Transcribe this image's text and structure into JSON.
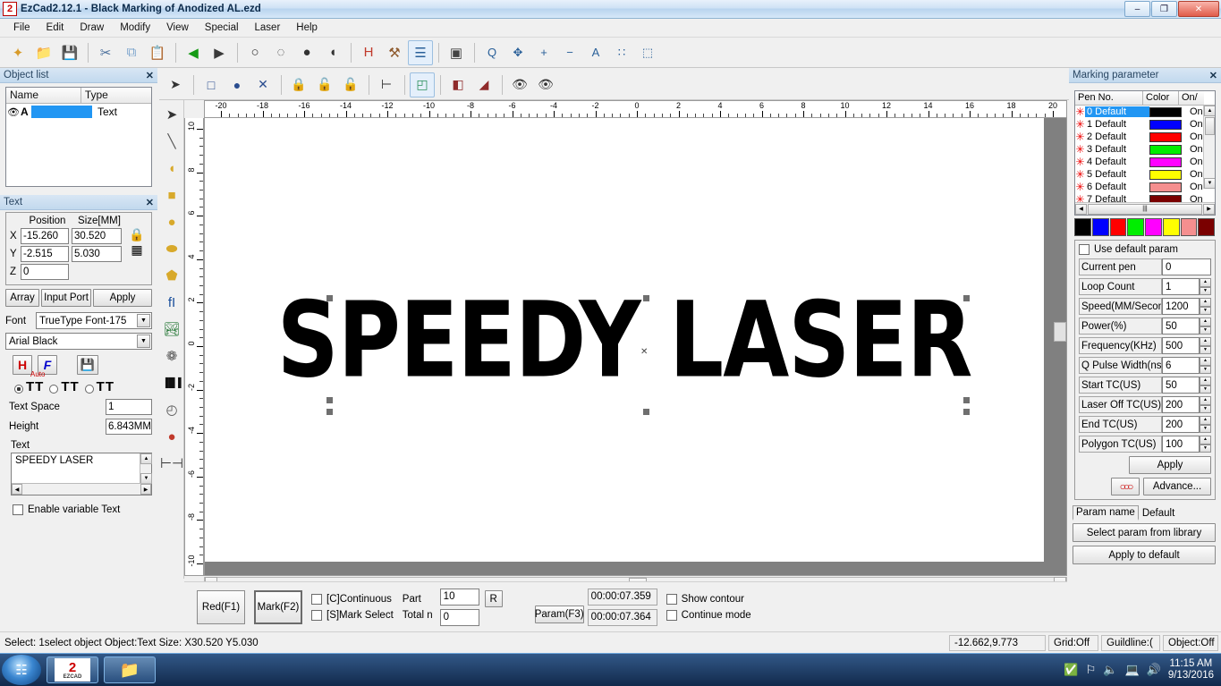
{
  "window": {
    "title": "EzCad2.12.1 - Black Marking of Anodized AL.ezd",
    "app_icon": "ezcad-logo-icon",
    "minimize": "–",
    "maximize": "❐",
    "close": "✕"
  },
  "menu": [
    "File",
    "Edit",
    "Draw",
    "Modify",
    "View",
    "Special",
    "Laser",
    "Help"
  ],
  "toolbar_main": [
    {
      "name": "new-icon",
      "glyph": "✦"
    },
    {
      "name": "open-icon",
      "glyph": "📁"
    },
    {
      "name": "save-icon",
      "glyph": "💾"
    },
    {
      "name": "cut-icon",
      "glyph": "✂"
    },
    {
      "name": "copy-icon",
      "glyph": "⧉"
    },
    {
      "name": "paste-icon",
      "glyph": "📋"
    },
    {
      "name": "undo-icon",
      "glyph": "◀"
    },
    {
      "name": "redo-icon",
      "glyph": "▶"
    },
    {
      "name": "group-icon",
      "glyph": "○"
    },
    {
      "name": "ungroup-icon",
      "glyph": "◌"
    },
    {
      "name": "combine-icon",
      "glyph": "●"
    },
    {
      "name": "uncombine-icon",
      "glyph": "◖"
    },
    {
      "name": "hatch-icon",
      "glyph": "H"
    },
    {
      "name": "tools-icon",
      "glyph": "⚒"
    },
    {
      "name": "properties-icon",
      "glyph": "☰"
    },
    {
      "name": "align-icon",
      "glyph": "▣"
    }
  ],
  "toolbar_zoom": [
    {
      "name": "zoom-tool-icon",
      "glyph": "Q"
    },
    {
      "name": "zoom-pan-icon",
      "glyph": "✥"
    },
    {
      "name": "zoom-in-icon",
      "glyph": "+"
    },
    {
      "name": "zoom-out-icon",
      "glyph": "−"
    },
    {
      "name": "zoom-all-icon",
      "glyph": "A"
    },
    {
      "name": "zoom-selected-icon",
      "glyph": "∷"
    },
    {
      "name": "zoom-page-icon",
      "glyph": "⬚"
    }
  ],
  "toolbar_object": [
    {
      "name": "select-arrow-icon",
      "glyph": "➤"
    },
    {
      "name": "node-edit-icon",
      "glyph": "□"
    },
    {
      "name": "curve-edit-icon",
      "glyph": "●"
    },
    {
      "name": "delete-node-icon",
      "glyph": "✕"
    },
    {
      "name": "lock-icon",
      "glyph": "🔒"
    },
    {
      "name": "unlock-icon",
      "glyph": "🔓"
    },
    {
      "name": "unlock-all-icon",
      "glyph": "🔓"
    },
    {
      "name": "set-origin-icon",
      "glyph": "⊢"
    },
    {
      "name": "color-layers-icon",
      "glyph": "◰"
    },
    {
      "name": "mirror-horizontal-icon",
      "glyph": "◧"
    },
    {
      "name": "mirror-vertical-icon",
      "glyph": "◢"
    },
    {
      "name": "show-all-icon",
      "glyph": "👁"
    },
    {
      "name": "hide-icon",
      "glyph": "👁"
    }
  ],
  "draw_tools": [
    {
      "name": "pick-tool-icon",
      "glyph": "➤"
    },
    {
      "name": "line-tool-icon",
      "glyph": "╲"
    },
    {
      "name": "curve-tool-icon",
      "glyph": "◖"
    },
    {
      "name": "rectangle-tool-icon",
      "glyph": "■"
    },
    {
      "name": "circle-tool-icon",
      "glyph": "●"
    },
    {
      "name": "ellipse-tool-icon",
      "glyph": "⬬"
    },
    {
      "name": "polygon-tool-icon",
      "glyph": "⬟"
    },
    {
      "name": "text-tool-icon",
      "glyph": "fI"
    },
    {
      "name": "bitmap-tool-icon",
      "glyph": "🏞"
    },
    {
      "name": "vector-file-icon",
      "glyph": "❁"
    },
    {
      "name": "barcode-tool-icon",
      "glyph": "▐█▐"
    },
    {
      "name": "timer-tool-icon",
      "glyph": "◴"
    },
    {
      "name": "input-port-icon",
      "glyph": "●"
    },
    {
      "name": "dimension-tool-icon",
      "glyph": "⊢⊣"
    }
  ],
  "object_list": {
    "panel_title": "Object list",
    "close": "✕",
    "columns": [
      "Name",
      "Type"
    ],
    "rows": [
      {
        "eye_icon": "eye-icon",
        "name": "A",
        "type": "Text",
        "selected": true
      }
    ]
  },
  "text_panel": {
    "panel_title": "Text",
    "close": "✕",
    "position_label": "Position",
    "size_label": "Size[MM]",
    "lock_icon": "lock-icon",
    "grid_icon": "anchor-grid-icon",
    "fields": [
      {
        "axis": "X",
        "pos": "-15.260",
        "size": "30.520"
      },
      {
        "axis": "Y",
        "pos": "-2.515",
        "size": "5.030"
      },
      {
        "axis": "Z",
        "pos": "0",
        "size": ""
      }
    ],
    "buttons": [
      "Array",
      "Input Port",
      "Apply"
    ],
    "font_label": "Font",
    "font_type": "TrueType Font-175",
    "font_name": "Arial Black",
    "icon_buttons": [
      {
        "name": "hatch-text-icon",
        "glyph": "H"
      },
      {
        "name": "font-format-icon",
        "glyph": "F"
      },
      {
        "name": "save-font-icon",
        "glyph": "💾"
      }
    ],
    "spacing_modes": [
      {
        "name": "auto-spacing-radio",
        "label": "Auto",
        "selected": true
      },
      {
        "name": "equal-spacing-radio",
        "label": "",
        "selected": false
      },
      {
        "name": "fixed-spacing-radio",
        "label": "",
        "selected": false
      }
    ],
    "text_space_label": "Text Space",
    "text_space_value": "1",
    "height_label": "Height",
    "height_value": "6.843MM",
    "text_label": "Text",
    "text_value": "SPEEDY LASER",
    "enable_variable_label": "Enable variable Text",
    "enable_variable_checked": false
  },
  "canvas": {
    "artwork_text": "SPEEDY LASER",
    "ruler_h_ticks": [
      -20,
      -18,
      -16,
      -14,
      -12,
      -10,
      -8,
      -6,
      -4,
      -2,
      0,
      2,
      4,
      6,
      8,
      10,
      12,
      14,
      16,
      18,
      20
    ],
    "ruler_v_ticks": [
      10,
      8,
      6,
      4,
      2,
      0,
      -2,
      -4,
      -6,
      -8,
      -10
    ],
    "paper_color": "#ffffff",
    "background_color": "#808080"
  },
  "marking_parameter": {
    "panel_title": "Marking parameter",
    "close": "✕",
    "columns": [
      "Pen No.",
      "Color",
      "On/"
    ],
    "pens": [
      {
        "no": "0 Default",
        "color": "#000000",
        "on": "On",
        "selected": true
      },
      {
        "no": "1 Default",
        "color": "#0000ff",
        "on": "On",
        "selected": false
      },
      {
        "no": "2 Default",
        "color": "#ff0000",
        "on": "On",
        "selected": false
      },
      {
        "no": "3 Default",
        "color": "#00ee00",
        "on": "On",
        "selected": false
      },
      {
        "no": "4 Default",
        "color": "#ff00ff",
        "on": "On",
        "selected": false
      },
      {
        "no": "5 Default",
        "color": "#ffff00",
        "on": "On",
        "selected": false
      },
      {
        "no": "6 Default",
        "color": "#f58f8f",
        "on": "On",
        "selected": false
      },
      {
        "no": "7 Default",
        "color": "#7a0000",
        "on": "On",
        "selected": false
      }
    ],
    "palette": [
      "#000000",
      "#0000ff",
      "#ff0000",
      "#00ee00",
      "#ff00ff",
      "#ffff00",
      "#f58f8f",
      "#7a0000"
    ],
    "use_default_param_label": "Use default param",
    "use_default_param_checked": false,
    "params": [
      {
        "label": "Current pen",
        "value": "0",
        "spinner": false
      },
      {
        "label": "Loop Count",
        "value": "1",
        "spinner": true
      },
      {
        "label": "Speed(MM/Secon",
        "value": "1200",
        "spinner": true
      },
      {
        "label": "Power(%)",
        "value": "50",
        "spinner": true
      },
      {
        "label": "Frequency(KHz)",
        "value": "500",
        "spinner": true
      },
      {
        "label": "Q Pulse Width(ns)",
        "value": "6",
        "spinner": true
      },
      {
        "label": "Start TC(US)",
        "value": "50",
        "spinner": true
      },
      {
        "label": "Laser Off TC(US)",
        "value": "200",
        "spinner": true
      },
      {
        "label": "End TC(US)",
        "value": "200",
        "spinner": true
      },
      {
        "label": "Polygon TC(US)",
        "value": "100",
        "spinner": true
      }
    ],
    "apply_label": "Apply",
    "advance_label": "Advance...",
    "advance_icon": "chain-rings-icon",
    "param_name_label": "Param name",
    "param_name_value": "Default",
    "select_library_label": "Select param from library",
    "apply_default_label": "Apply to default"
  },
  "bottom_bar": {
    "red_button": "Red(F1)",
    "mark_button": "Mark(F2)",
    "continuous_label": "[C]Continuous",
    "continuous_checked": false,
    "mark_select_label": "[S]Mark Select",
    "mark_select_checked": false,
    "part_label": "Part",
    "part_value": "10",
    "reset_button": "R",
    "total_label": "Total n",
    "total_value": "0",
    "param_button": "Param(F3)",
    "time1": "00:00:07.359",
    "time2": "00:00:07.364",
    "show_contour_label": "Show contour",
    "show_contour_checked": false,
    "continue_mode_label": "Continue mode",
    "continue_mode_checked": false
  },
  "status_bar": {
    "message": "Select: 1select object Object:Text Size: X30.520 Y5.030",
    "coords": "-12.662,9.773",
    "grid": "Grid:Off",
    "guideline": "Guildline:(",
    "object": "Object:Off"
  },
  "taskbar": {
    "start_icon": "windows-start-icon",
    "tasks": [
      {
        "name": "taskbar-item-ezcad",
        "glyph": "2",
        "sub": "EZCAD"
      },
      {
        "name": "taskbar-item-explorer",
        "glyph": "📁",
        "sub": ""
      }
    ],
    "tray_icons": [
      {
        "name": "action-center-icon",
        "glyph": "✅"
      },
      {
        "name": "network-flag-icon",
        "glyph": "⚑"
      },
      {
        "name": "volume-mute-icon",
        "glyph": "🔈"
      },
      {
        "name": "display-icon",
        "glyph": "🖥"
      },
      {
        "name": "volume-icon",
        "glyph": "🔊"
      }
    ],
    "time": "11:15 AM",
    "date": "9/13/2016"
  }
}
